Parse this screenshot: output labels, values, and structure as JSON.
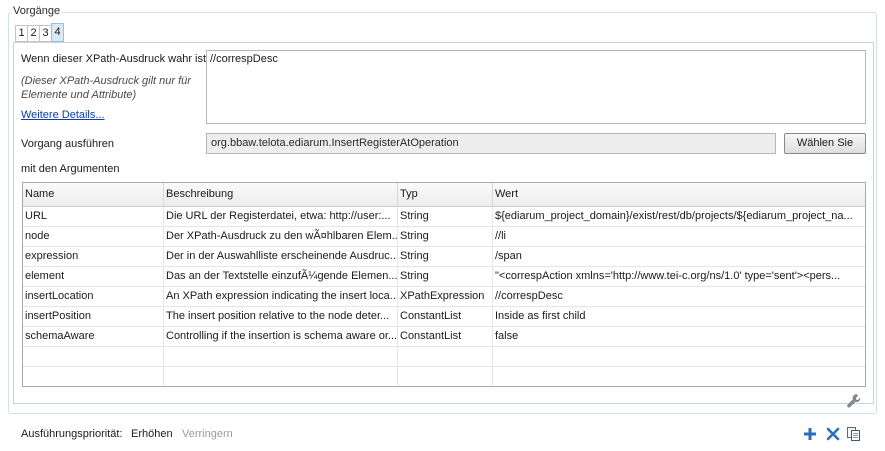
{
  "group": {
    "title": "Vorgänge"
  },
  "tabs": [
    "1",
    "2",
    "3",
    "4"
  ],
  "condition": {
    "label": "Wenn dieser XPath-Ausdruck wahr ist",
    "note": "(Dieser XPath-Ausdruck gilt nur für Elemente und Attribute)",
    "more_link": "Weitere Details...",
    "value": "//correspDesc"
  },
  "operation": {
    "label": "Vorgang ausführen",
    "value": "org.bbaw.telota.ediarum.InsertRegisterAtOperation",
    "choose_button": "Wählen Sie"
  },
  "arguments": {
    "label": "mit den Argumenten",
    "columns": [
      "Name",
      "Beschreibung",
      "Typ",
      "Wert"
    ],
    "rows": [
      [
        "URL",
        "Die URL der Registerdatei, etwa: http://user:...",
        "String",
        "${ediarum_project_domain}/exist/rest/db/projects/${ediarum_project_na..."
      ],
      [
        "node",
        "Der XPath-Ausdruck zu den wÃ¤hlbaren Elem...",
        "String",
        "//li"
      ],
      [
        "expression",
        "Der in der Auswahlliste erscheinende Ausdruc...",
        "String",
        "/span"
      ],
      [
        "element",
        "Das an der Textstelle einzufÃ¼gende Elemen...",
        "String",
        "\"<correspAction xmlns='http://www.tei-c.org/ns/1.0' type='sent'><pers..."
      ],
      [
        "insertLocation",
        "An XPath expression indicating the insert loca...",
        "XPathExpression",
        "//correspDesc"
      ],
      [
        "insertPosition",
        "The insert position relative to the node deter...",
        "ConstantList",
        "Inside as first child"
      ],
      [
        "schemaAware",
        "Controlling if the insertion is schema aware or...",
        "ConstantList",
        "false"
      ],
      [
        "",
        "",
        "",
        ""
      ],
      [
        "",
        "",
        "",
        ""
      ]
    ]
  },
  "footer": {
    "priority_label": "Ausführungspriorität:",
    "raise": "Erhöhen",
    "lower": "Verringern"
  },
  "icons": {
    "edit": "wrench-icon",
    "add": "plus-icon",
    "remove": "delete-icon",
    "duplicate": "copy-icon"
  },
  "colors": {
    "add": "#2a6fbe",
    "remove": "#2a6fbe",
    "active_tab": "#d9eaf7"
  }
}
